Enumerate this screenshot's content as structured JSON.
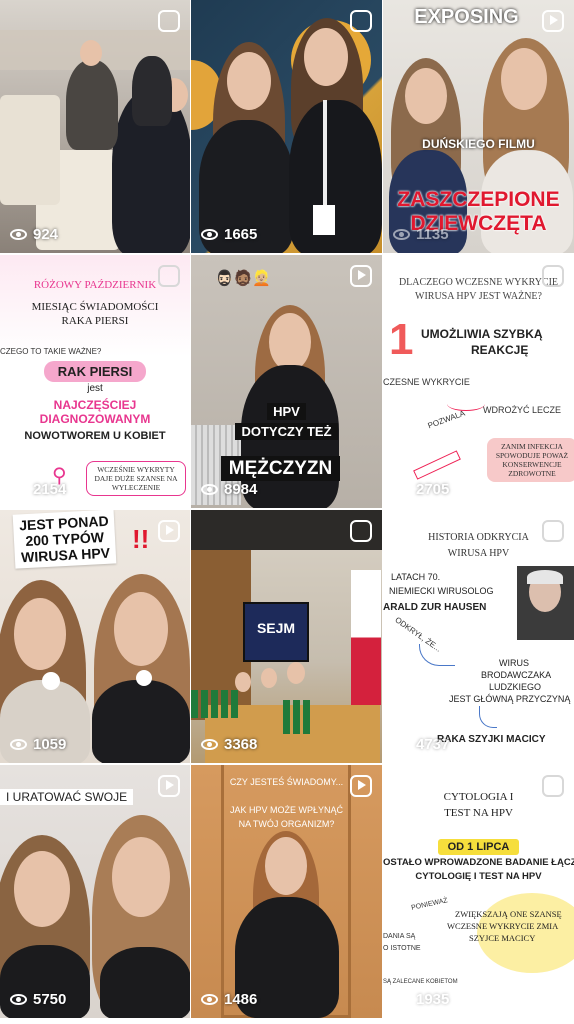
{
  "tiles": [
    {
      "views": "924"
    },
    {
      "views": "1665"
    },
    {
      "views": "1135",
      "title": "EXPOSING",
      "sub": "DUŃSKIEGO FILMU",
      "big1": "ZASZCZEPIONE",
      "big2": "DZIEWCZĘTA"
    },
    {
      "views": "2154",
      "h1": "RÓŻOWY PAŹDZIERNIK",
      "h2": "MIESIĄC ŚWIADOMOŚCI",
      "h3": "RAKA PIERSI",
      "q": "CZEGO TO TAKIE WAŻNE?",
      "pill": "RAK PIERSI",
      "jest": "jest",
      "pink1": "NAJCZĘŚCIEJ",
      "pink2": "DIAGNOZOWANYM",
      "dark": "NOWOTWOREM U KOBIET",
      "box": "WCZEŚNIE WYKRYTY DAJE DUŻE SZANSE NA WYLECZENIE"
    },
    {
      "views": "8984",
      "c1": "HPV",
      "c2": "DOTYCZY TEŻ",
      "c3": "MĘŻCZYZN"
    },
    {
      "views": "2705",
      "h1": "DLACZEGO WCZESNE WYKRYCIE",
      "h2": "WIRUSA HPV JEST WAŻNE?",
      "num": "1",
      "head1": "UMOŻLIWIA SZYBKĄ",
      "head2": "REAKCJĘ",
      "l1": "CZESNE WYKRYCIE",
      "l2": "POZWALA",
      "l3": "WDROŻYĆ LECZE",
      "box": "ZANIM INFEKCJA SPOWODUJE POWAŻ KONSERWENCJE ZDROWOTNE"
    },
    {
      "views": "1059",
      "c1": "JEST PONAD",
      "c2": "200 TYPÓW",
      "c3": "WIRUSA HPV",
      "ex": "!!"
    },
    {
      "views": "3368",
      "sign": "SEJM"
    },
    {
      "views": "4737",
      "h1": "HISTORIA ODKRYCIA",
      "h2": "WIRUSA HPV",
      "l1": "LATACH 70.",
      "l2": "NIEMIECKI WIRUSOLOG",
      "l3": "ARALD ZUR HAUSEN",
      "l4": "ODKRYŁ, ŻE...",
      "l5": "WIRUS",
      "l6": "BRODAWCZAKA",
      "l7": "LUDZKIEGO",
      "l8": "JEST GŁÓWNĄ PRZYCZYNĄ",
      "l9": "RAKA SZYJKI MACICY"
    },
    {
      "views": "5750",
      "cap": "I URATOWAĆ SWOJE"
    },
    {
      "views": "1486",
      "c1": "CZY JESTEŚ ŚWIADOMY...",
      "c2": "JAK HPV MOŻE WPŁYNĄĆ",
      "c3": "NA TWÓJ ORGANIZM?"
    },
    {
      "views": "1935",
      "h1": "CYTOLOGIA I",
      "h2": "TEST NA HPV",
      "tag": "OD 1 LIPCA",
      "l1": "OSTAŁO WPROWADZONE BADANIE ŁĄCZ",
      "l2": "CYTOLOGIĘ I TEST NA HPV",
      "l3": "PONIEWAŻ",
      "l4": "ZWIĘKSZAJĄ ONE SZANSĘ",
      "l5": "WCZESNE WYKRYCIE ZMIA",
      "l6": "SZYJCE MACICY",
      "l7": "DANIA SĄ",
      "l8": "O ISTOTNE",
      "l9": "SĄ ZALECANE KOBIETOM"
    }
  ],
  "colors": {
    "pink": "#e8368f",
    "red": "#e0182f",
    "peach": "#f5d9c8"
  }
}
